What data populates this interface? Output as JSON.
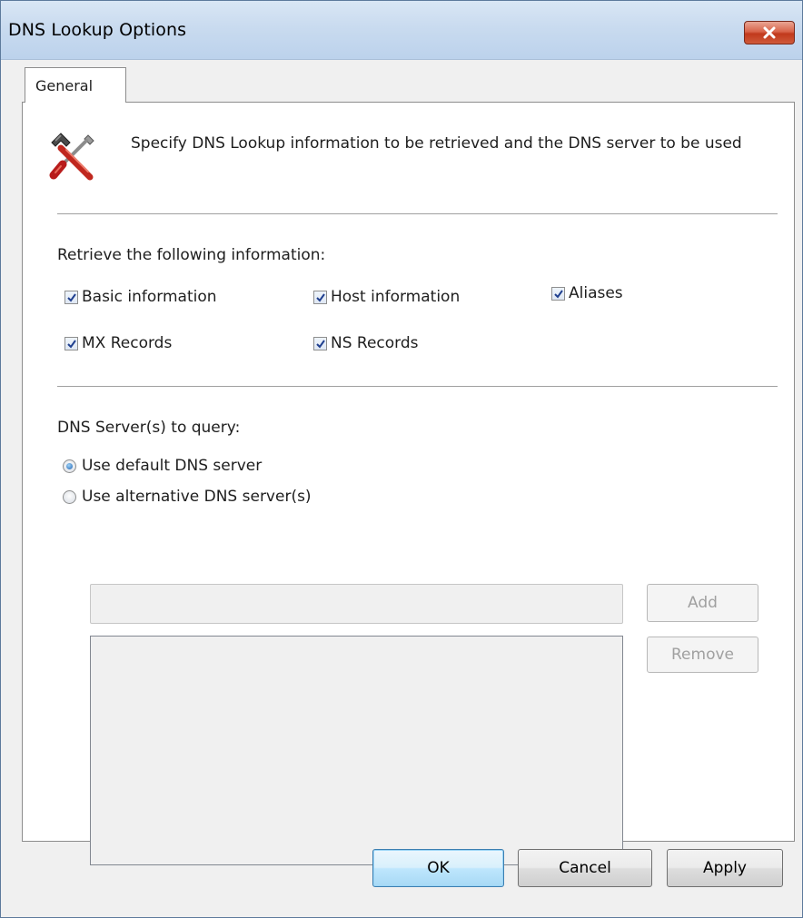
{
  "window": {
    "title": "DNS Lookup Options"
  },
  "tabs": [
    {
      "label": "General"
    }
  ],
  "general": {
    "description": "Specify DNS Lookup information to be retrieved and the DNS server to be used",
    "retrieve_label": "Retrieve the following information:",
    "options": [
      {
        "label": "Basic information",
        "checked": true
      },
      {
        "label": "Host information",
        "checked": true
      },
      {
        "label": "Aliases",
        "checked": true
      },
      {
        "label": "MX Records",
        "checked": true
      },
      {
        "label": "NS Records",
        "checked": true
      }
    ],
    "dns_label": "DNS Server(s) to query:",
    "radios": [
      {
        "label": "Use default DNS server",
        "selected": true
      },
      {
        "label": "Use alternative DNS server(s)",
        "selected": false
      }
    ],
    "server_input_value": "",
    "add_label": "Add",
    "remove_label": "Remove"
  },
  "footer": {
    "ok_label": "OK",
    "cancel_label": "Cancel",
    "apply_label": "Apply"
  }
}
